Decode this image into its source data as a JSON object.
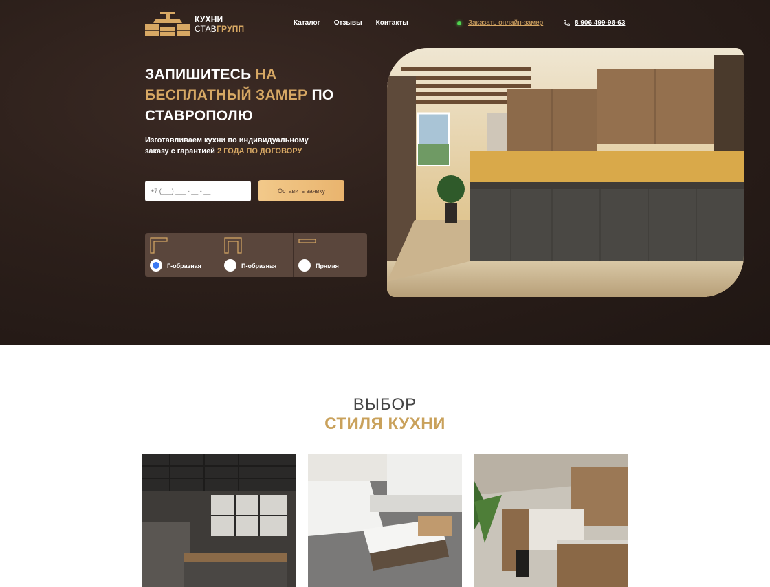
{
  "header": {
    "logo": {
      "line1": "КУХНИ",
      "line2_prefix": "СТАВ",
      "line2_accent": "ГРУПП"
    },
    "nav": [
      "Каталог",
      "Отзывы",
      "Контакты"
    ],
    "online_link": "Заказать онлайн-замер",
    "phone": "8 906 499-98-63"
  },
  "hero": {
    "headline_parts": [
      "ЗАПИШИТЕСЬ ",
      "НА",
      "БЕСПЛАТНЫЙ ЗАМЕР",
      " ПО",
      "СТАВРОПОЛЮ"
    ],
    "subtitle_main": "Изготавливаем кухни по индивидуальному заказу с гарантией ",
    "subtitle_accent": "2 года по договору",
    "phone_placeholder": "+7 (___) ___ - __ - __",
    "submit_label": "Оставить заявку",
    "shapes": [
      {
        "label": "Г-образная",
        "selected": true
      },
      {
        "label": "П-образная",
        "selected": false
      },
      {
        "label": "Прямая",
        "selected": false
      }
    ]
  },
  "styles_section": {
    "title_line1": "ВЫБОР",
    "title_line2": "СТИЛЯ КУХНИ"
  },
  "colors": {
    "gold": "#d7a864",
    "hero_bg": "#2d201b",
    "online_dot": "#4fd34f",
    "radio_blue": "#3a78f2"
  }
}
